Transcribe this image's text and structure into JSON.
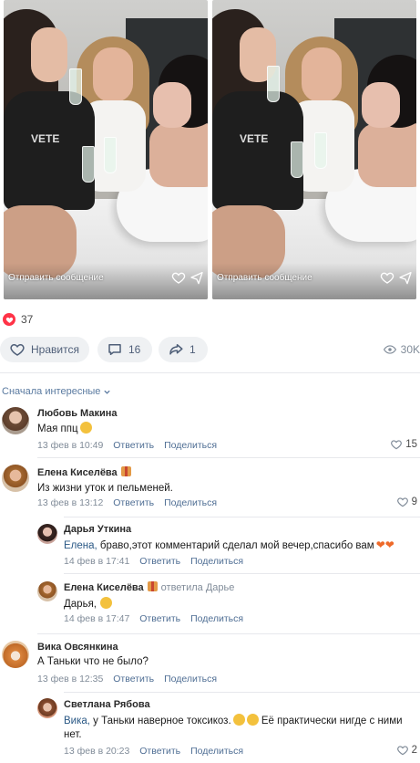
{
  "video": {
    "frames": [
      {
        "message_placeholder": "Отправить сообщение",
        "shirt_text": "VETE"
      },
      {
        "message_placeholder": "Отправить сообщение",
        "shirt_text": "VETE"
      }
    ]
  },
  "post": {
    "likes_count": "37",
    "like_label": "Нравится",
    "comments_count": "16",
    "shares_count": "1",
    "views_count": "30K"
  },
  "sort_label": "Сначала интересные",
  "colors": {
    "accent": "#4f6e94",
    "heart": "#ff3347",
    "pill_bg": "#eff1f3"
  },
  "comments": [
    {
      "name": "Любовь Макина",
      "text": "Мая ппц",
      "date": "13 фев в 10:49",
      "reply": "Ответить",
      "share": "Поделиться",
      "likes": "15"
    },
    {
      "name": "Елена Киселёва",
      "text": "Из жизни уток и пельменей.",
      "date": "13 фев в 13:12",
      "reply": "Ответить",
      "share": "Поделиться",
      "likes": "9",
      "replies": [
        {
          "name": "Дарья Уткина",
          "mention": "Елена,",
          "text": " браво,этот комментарий сделал мой вечер,спасибо вам",
          "date": "14 фев в 17:41",
          "reply": "Ответить",
          "share": "Поделиться"
        },
        {
          "name": "Елена Киселёва",
          "reply_to": "ответила Дарье",
          "mention": "Дарья,",
          "text": "",
          "date": "14 фев в 17:47",
          "reply": "Ответить",
          "share": "Поделиться"
        }
      ]
    },
    {
      "name": "Вика Овсянкина",
      "text": "А Таньки что не было?",
      "date": "13 фев в 12:35",
      "reply": "Ответить",
      "share": "Поделиться",
      "replies": [
        {
          "name": "Светлана Рябова",
          "mention": "Вика,",
          "text": " у Таньки наверное токсикоз.",
          "text2": " Её практически нигде с ними",
          "text3": "нет.",
          "date": "13 фев в 20:23",
          "reply": "Ответить",
          "share": "Поделиться",
          "likes": "2"
        }
      ]
    }
  ]
}
